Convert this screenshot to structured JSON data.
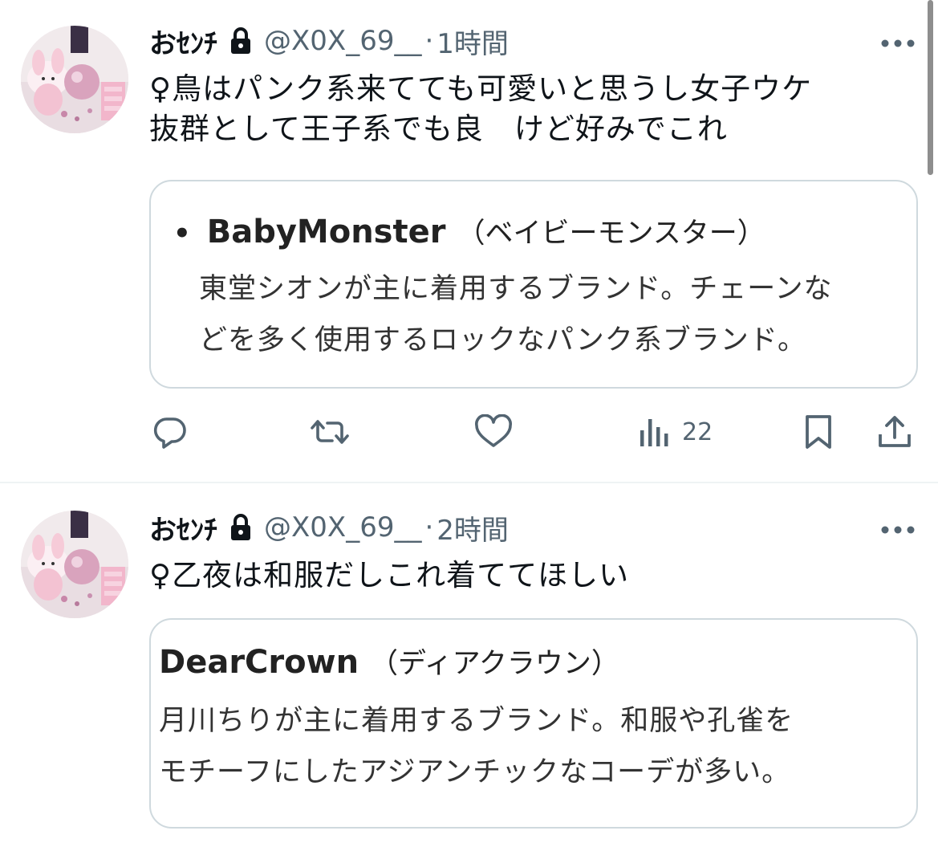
{
  "tweets": [
    {
      "user": {
        "display_name": "おｾﾝﾁ",
        "handle": "@X0X_69__",
        "protected_icon": "lock-icon",
        "avatar_icon": "avatar-image"
      },
      "separator": "·",
      "time": "1時間",
      "text_lines": [
        "♀鳥はパンク系来てても可愛いと思うし女子ウケ",
        "抜群として王子系でも良　けど好みでこれ"
      ],
      "card": {
        "bullet": "•",
        "title": "BabyMonster",
        "kana": "（ベイビーモンスター）",
        "desc_lines": [
          "東堂シオンが主に着用するブランド。チェーンな",
          "どを多く使用するロックなパンク系ブランド。"
        ]
      },
      "actions": {
        "reply_icon": "reply-icon",
        "retweet_icon": "retweet-icon",
        "like_icon": "like-icon",
        "views_icon": "views-icon",
        "views_count": "22",
        "bookmark_icon": "bookmark-icon",
        "share_icon": "share-icon"
      }
    },
    {
      "user": {
        "display_name": "おｾﾝﾁ",
        "handle": "@X0X_69__",
        "protected_icon": "lock-icon",
        "avatar_icon": "avatar-image"
      },
      "separator": "·",
      "time": "2時間",
      "text_lines": [
        "♀乙夜は和服だしこれ着ててほしい"
      ],
      "card": {
        "title": "DearCrown",
        "kana": "（ディアクラウン）",
        "desc_lines": [
          "月川ちりが主に着用するブランド。和服や孔雀を",
          "モチーフにしたアジアンチックなコーデが多い。"
        ]
      }
    }
  ],
  "colors": {
    "text_primary": "#0f1419",
    "text_secondary": "#536471",
    "border": "#cfd9de",
    "divider": "#eff3f4"
  }
}
